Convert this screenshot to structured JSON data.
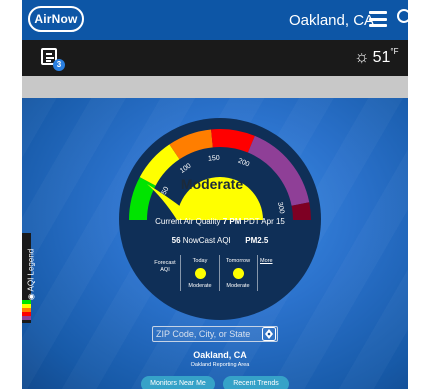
{
  "header": {
    "logo_text": "AirNow",
    "location": "Oakland, CA",
    "notification_count": "3",
    "weather_temp": "51",
    "weather_unit": "°F"
  },
  "gauge": {
    "category": "Moderate",
    "tick_labels": [
      "50",
      "100",
      "150",
      "200",
      "300"
    ],
    "band_colors": {
      "good": "#00e400",
      "moderate": "#ffff00",
      "usg": "#ff7e00",
      "unhealthy": "#ff0000",
      "very_unhealthy": "#8f3f97",
      "hazardous": "#7e0023"
    },
    "current_text_prefix": "Current Air Quality",
    "current_time": "7 PM",
    "current_suffix": "PDT Apr 15",
    "nowcast_value": "56",
    "nowcast_label": "NowCast AQI",
    "pollutant": "PM2.5"
  },
  "forecast": {
    "label": "Forecast AQI",
    "today_label": "Today",
    "today_value": "Moderate",
    "tomorrow_label": "Tomorrow",
    "tomorrow_value": "Moderate",
    "more_label": "More"
  },
  "legend": {
    "label": "AQI Legend"
  },
  "search": {
    "placeholder": "ZIP Code, City, or State",
    "city": "Oakland, CA",
    "area": "Oakland Reporting Area"
  },
  "buttons": {
    "monitors": "Monitors Near Me",
    "trends": "Recent Trends"
  }
}
